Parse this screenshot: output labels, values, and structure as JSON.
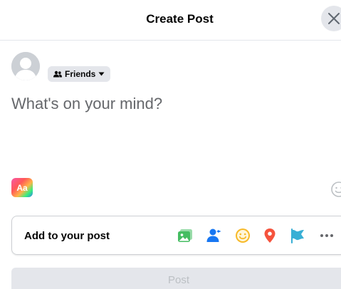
{
  "dialog": {
    "title": "Create Post",
    "close_icon": "close-icon"
  },
  "user": {
    "avatar_icon": "default-avatar-icon"
  },
  "audience": {
    "icon": "friends-icon",
    "label": "Friends",
    "dropdown_icon": "caret-down-icon"
  },
  "composer": {
    "placeholder": "What's on your mind?"
  },
  "background_picker": {
    "label": "Aa"
  },
  "emoji_icon": "emoji-icon",
  "add_to_post": {
    "label": "Add to your post",
    "tools": [
      {
        "name": "photo-video",
        "icon": "photo-icon",
        "color": "#45bd62"
      },
      {
        "name": "tag-people",
        "icon": "tag-people-icon",
        "color": "#1877f2"
      },
      {
        "name": "feeling-activity",
        "icon": "feeling-icon",
        "color": "#f7b928"
      },
      {
        "name": "check-in",
        "icon": "location-pin-icon",
        "color": "#f5533d"
      },
      {
        "name": "life-event",
        "icon": "flag-icon",
        "color": "#39afd5"
      },
      {
        "name": "more",
        "icon": "more-icon",
        "color": "#65676b"
      }
    ]
  },
  "post_button": {
    "label": "Post"
  },
  "colors": {
    "divider": "#e4e6eb",
    "secondary_text": "#65676b",
    "disabled_button": "#e4e6eb",
    "disabled_text": "#bcc0c4"
  }
}
